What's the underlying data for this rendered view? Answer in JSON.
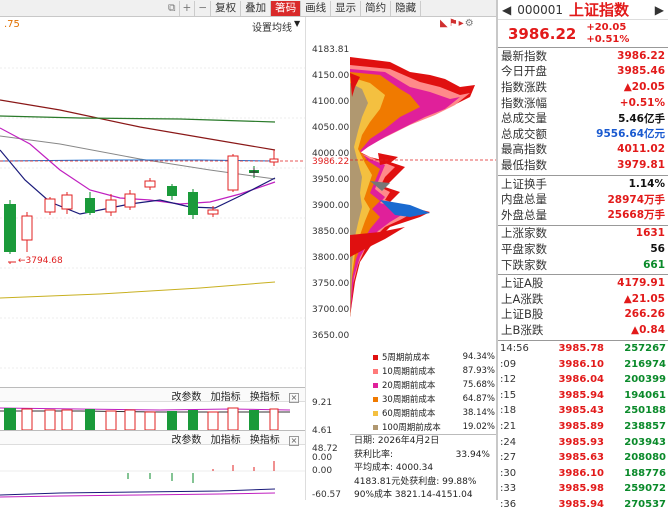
{
  "toolbar": {
    "items": [
      "复权",
      "叠加",
      "箸码",
      "画线",
      "显示",
      "简约",
      "隐藏"
    ],
    "active": "箸码"
  },
  "sub": {
    "ma_value": ".75",
    "settings": "设置均线"
  },
  "axis": {
    "price_ticks": [
      "4183.81",
      "4150.00",
      "4100.00",
      "4050.00",
      "4000.00",
      "3986.22",
      "3950.00",
      "3900.00",
      "3850.00",
      "3800.00",
      "3750.00",
      "3700.00",
      "3650.00"
    ],
    "vol_ticks": [
      "9.21",
      "4.61",
      "0.00"
    ],
    "ind_ticks": [
      "48.72",
      "0.00",
      "-60.57"
    ]
  },
  "chart": {
    "low_label": "3794.68",
    "current_price": "3986.22"
  },
  "indicator_bar": {
    "params": "改参数",
    "add": "加指标",
    "switch": "换指标",
    "close": "×"
  },
  "legend": [
    {
      "label": "5周期前成本",
      "pct": "94.34%",
      "color": "#e01010"
    },
    {
      "label": "10周期前成本",
      "pct": "87.93%",
      "color": "#ff7a7a"
    },
    {
      "label": "20周期前成本",
      "pct": "75.68%",
      "color": "#e0209a"
    },
    {
      "label": "30周期前成本",
      "pct": "64.87%",
      "color": "#f07a00"
    },
    {
      "label": "60周期前成本",
      "pct": "38.14%",
      "color": "#f4c040"
    },
    {
      "label": "100周期前成本",
      "pct": "19.02%",
      "color": "#b09870"
    }
  ],
  "info": {
    "date": "日期: 2026年4月2日",
    "profit_label": "获利比率:",
    "profit": "33.94%",
    "avg": "平均成本: 4000.34",
    "range": "4183.81元处获利盘: 99.88%",
    "cost": "90%成本 3821.14-4151.04"
  },
  "quote": {
    "code": "000001",
    "name": "上证指数",
    "price": "3986.22",
    "change": "+20.05",
    "pct": "+0.51%"
  },
  "stats1": [
    {
      "label": "最新指数",
      "value": "3986.22",
      "cls": "red"
    },
    {
      "label": "今日开盘",
      "value": "3985.46",
      "cls": "red"
    },
    {
      "label": "指数涨跌",
      "value": "▲20.05",
      "cls": "red"
    },
    {
      "label": "指数涨幅",
      "value": "+0.51%",
      "cls": "red"
    },
    {
      "label": "总成交量",
      "value": "5.46亿手",
      "cls": "blk"
    },
    {
      "label": "总成交额",
      "value": "9556.64亿元",
      "cls": "blu"
    },
    {
      "label": "最高指数",
      "value": "4011.02",
      "cls": "red"
    },
    {
      "label": "最低指数",
      "value": "3979.81",
      "cls": "red"
    }
  ],
  "stats2": [
    {
      "label": "上证换手",
      "value": "1.14%",
      "cls": "blk"
    },
    {
      "label": "内盘总量",
      "value": "28974万手",
      "cls": "red"
    },
    {
      "label": "外盘总量",
      "value": "25668万手",
      "cls": "red"
    }
  ],
  "stats3": [
    {
      "label": "上涨家数",
      "value": "1631",
      "cls": "red"
    },
    {
      "label": "平盘家数",
      "value": "56",
      "cls": "blk"
    },
    {
      "label": "下跌家数",
      "value": "661",
      "cls": "grn"
    }
  ],
  "stats4": [
    {
      "label": "上证A股",
      "value": "4179.91",
      "cls": "red"
    },
    {
      "label": "上A涨跌",
      "value": "▲21.05",
      "cls": "red"
    },
    {
      "label": "上证B股",
      "value": "266.26",
      "cls": "red"
    },
    {
      "label": "上B涨跌",
      "value": "▲0.84",
      "cls": "red"
    }
  ],
  "ticks": [
    {
      "t": "14:56",
      "p": "3985.78",
      "v": "257267"
    },
    {
      "t": ":09",
      "p": "3986.10",
      "v": "216974"
    },
    {
      "t": ":12",
      "p": "3986.04",
      "v": "200399"
    },
    {
      "t": ":15",
      "p": "3985.94",
      "v": "194061"
    },
    {
      "t": ":18",
      "p": "3985.43",
      "v": "250188"
    },
    {
      "t": ":21",
      "p": "3985.89",
      "v": "238857"
    },
    {
      "t": ":24",
      "p": "3985.93",
      "v": "203943"
    },
    {
      "t": ":27",
      "p": "3985.63",
      "v": "208080"
    },
    {
      "t": ":30",
      "p": "3986.10",
      "v": "188776"
    },
    {
      "t": ":33",
      "p": "3985.98",
      "v": "259072"
    },
    {
      "t": ":36",
      "p": "3985.94",
      "v": "270537"
    }
  ]
}
